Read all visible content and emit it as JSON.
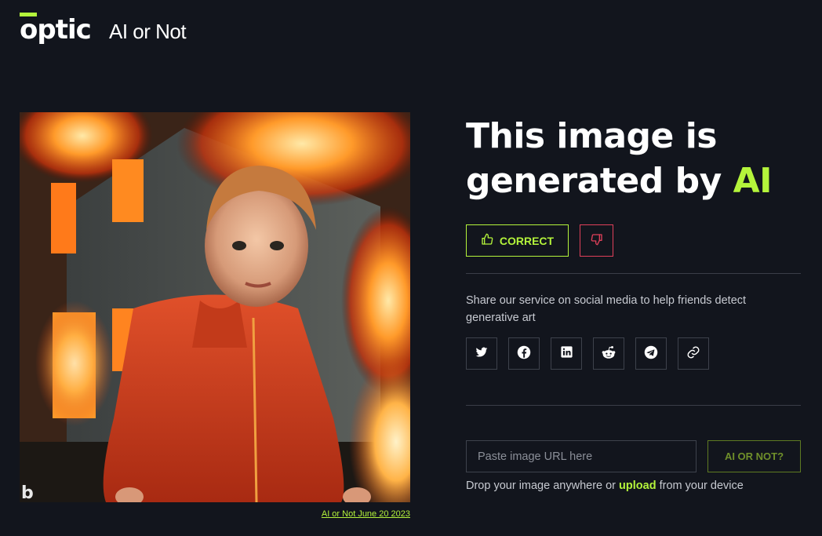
{
  "header": {
    "logo_text": "optic",
    "product_name": "AI or Not"
  },
  "image": {
    "caption": "AI or Not June 20 2023",
    "watermark": "b"
  },
  "result": {
    "title_prefix": "This image is generated by",
    "title_highlight": "AI",
    "correct_label": "CORRECT"
  },
  "share": {
    "text": "Share our service on social media to help friends detect generative art",
    "icons": [
      "twitter-icon",
      "facebook-icon",
      "linkedin-icon",
      "reddit-icon",
      "telegram-icon",
      "link-icon"
    ]
  },
  "check": {
    "placeholder": "Paste image URL here",
    "submit_label": "AI OR NOT?",
    "drop_before": "Drop your image anywhere or",
    "drop_link": "upload",
    "drop_after": "from your device"
  },
  "colors": {
    "background": "#12151d",
    "accent": "#b4f43b",
    "danger": "#e0405a"
  }
}
